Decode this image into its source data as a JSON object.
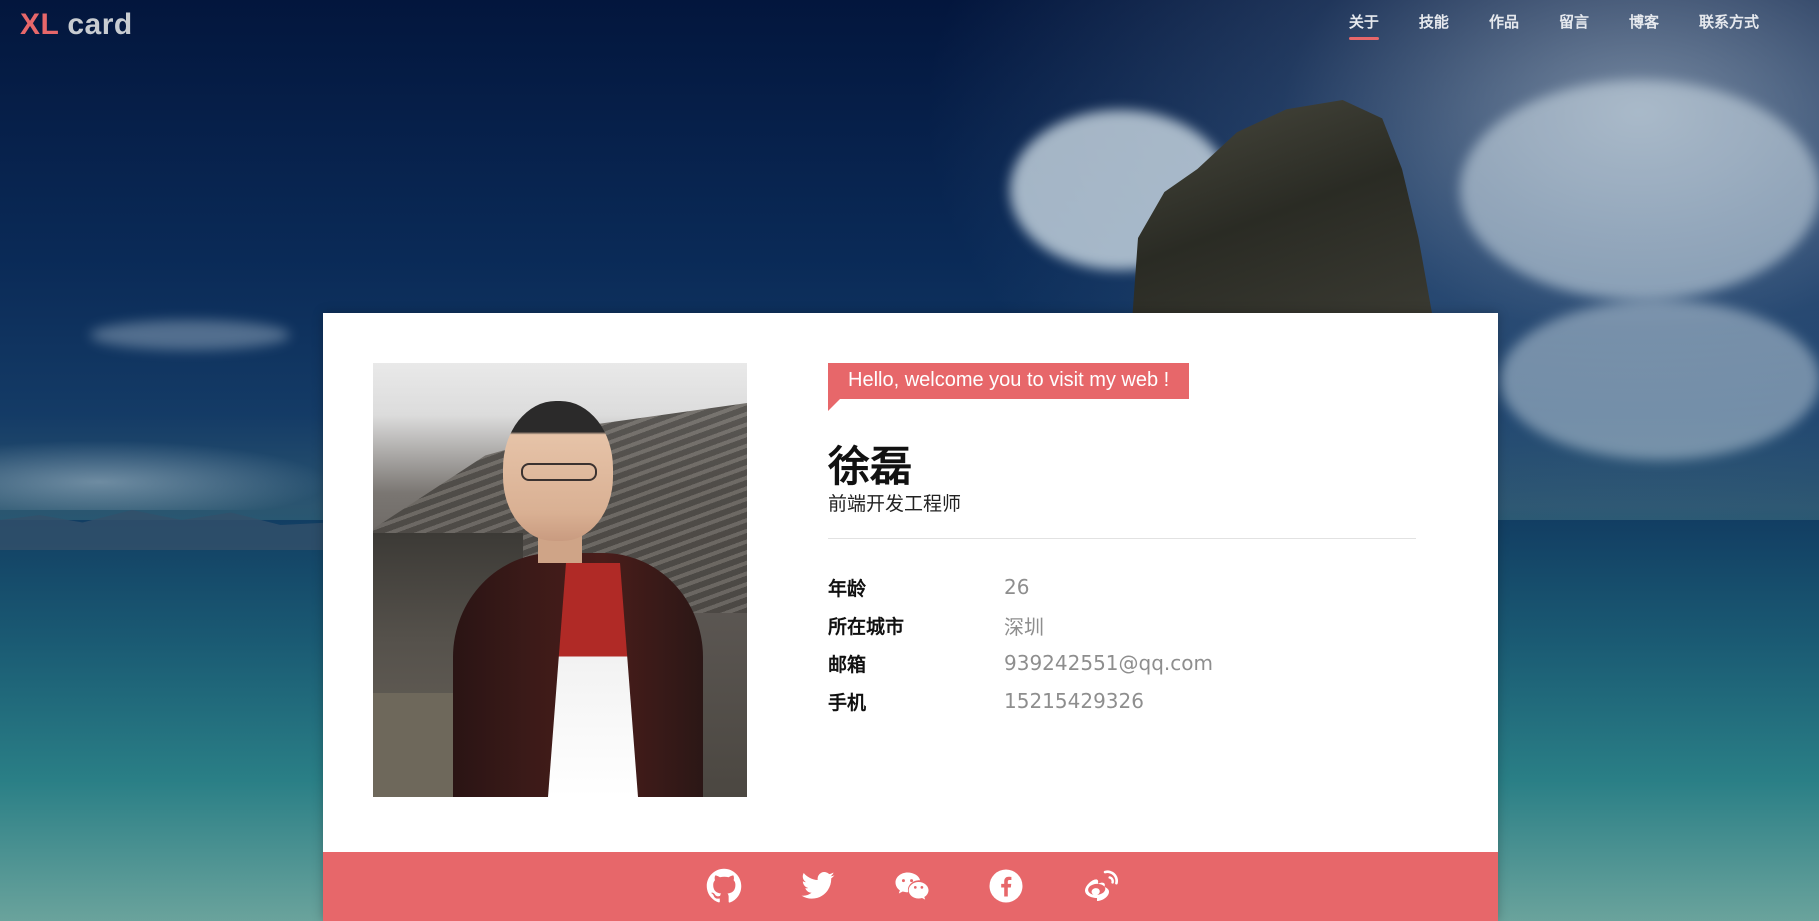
{
  "header": {
    "logo_primary": "XL",
    "logo_secondary": "card",
    "nav": [
      {
        "label": "关于",
        "active": true
      },
      {
        "label": "技能",
        "active": false
      },
      {
        "label": "作品",
        "active": false
      },
      {
        "label": "留言",
        "active": false
      },
      {
        "label": "博客",
        "active": false
      },
      {
        "label": "联系方式",
        "active": false
      }
    ]
  },
  "profile": {
    "greeting": "Hello, welcome you to visit my web !",
    "name": "徐磊",
    "title": "前端开发工程师",
    "info": [
      {
        "key": "年龄",
        "value": "26"
      },
      {
        "key": "所在城市",
        "value": "深圳"
      },
      {
        "key": "邮箱",
        "value": "939242551@qq.com"
      },
      {
        "key": "手机",
        "value": "15215429326"
      }
    ]
  },
  "social": {
    "icons": [
      "github-icon",
      "twitter-icon",
      "wechat-icon",
      "facebook-icon",
      "weibo-icon"
    ]
  },
  "colors": {
    "accent": "#e7676a",
    "logo_secondary": "#c8ccd1",
    "value_text": "#8e8e8e"
  }
}
